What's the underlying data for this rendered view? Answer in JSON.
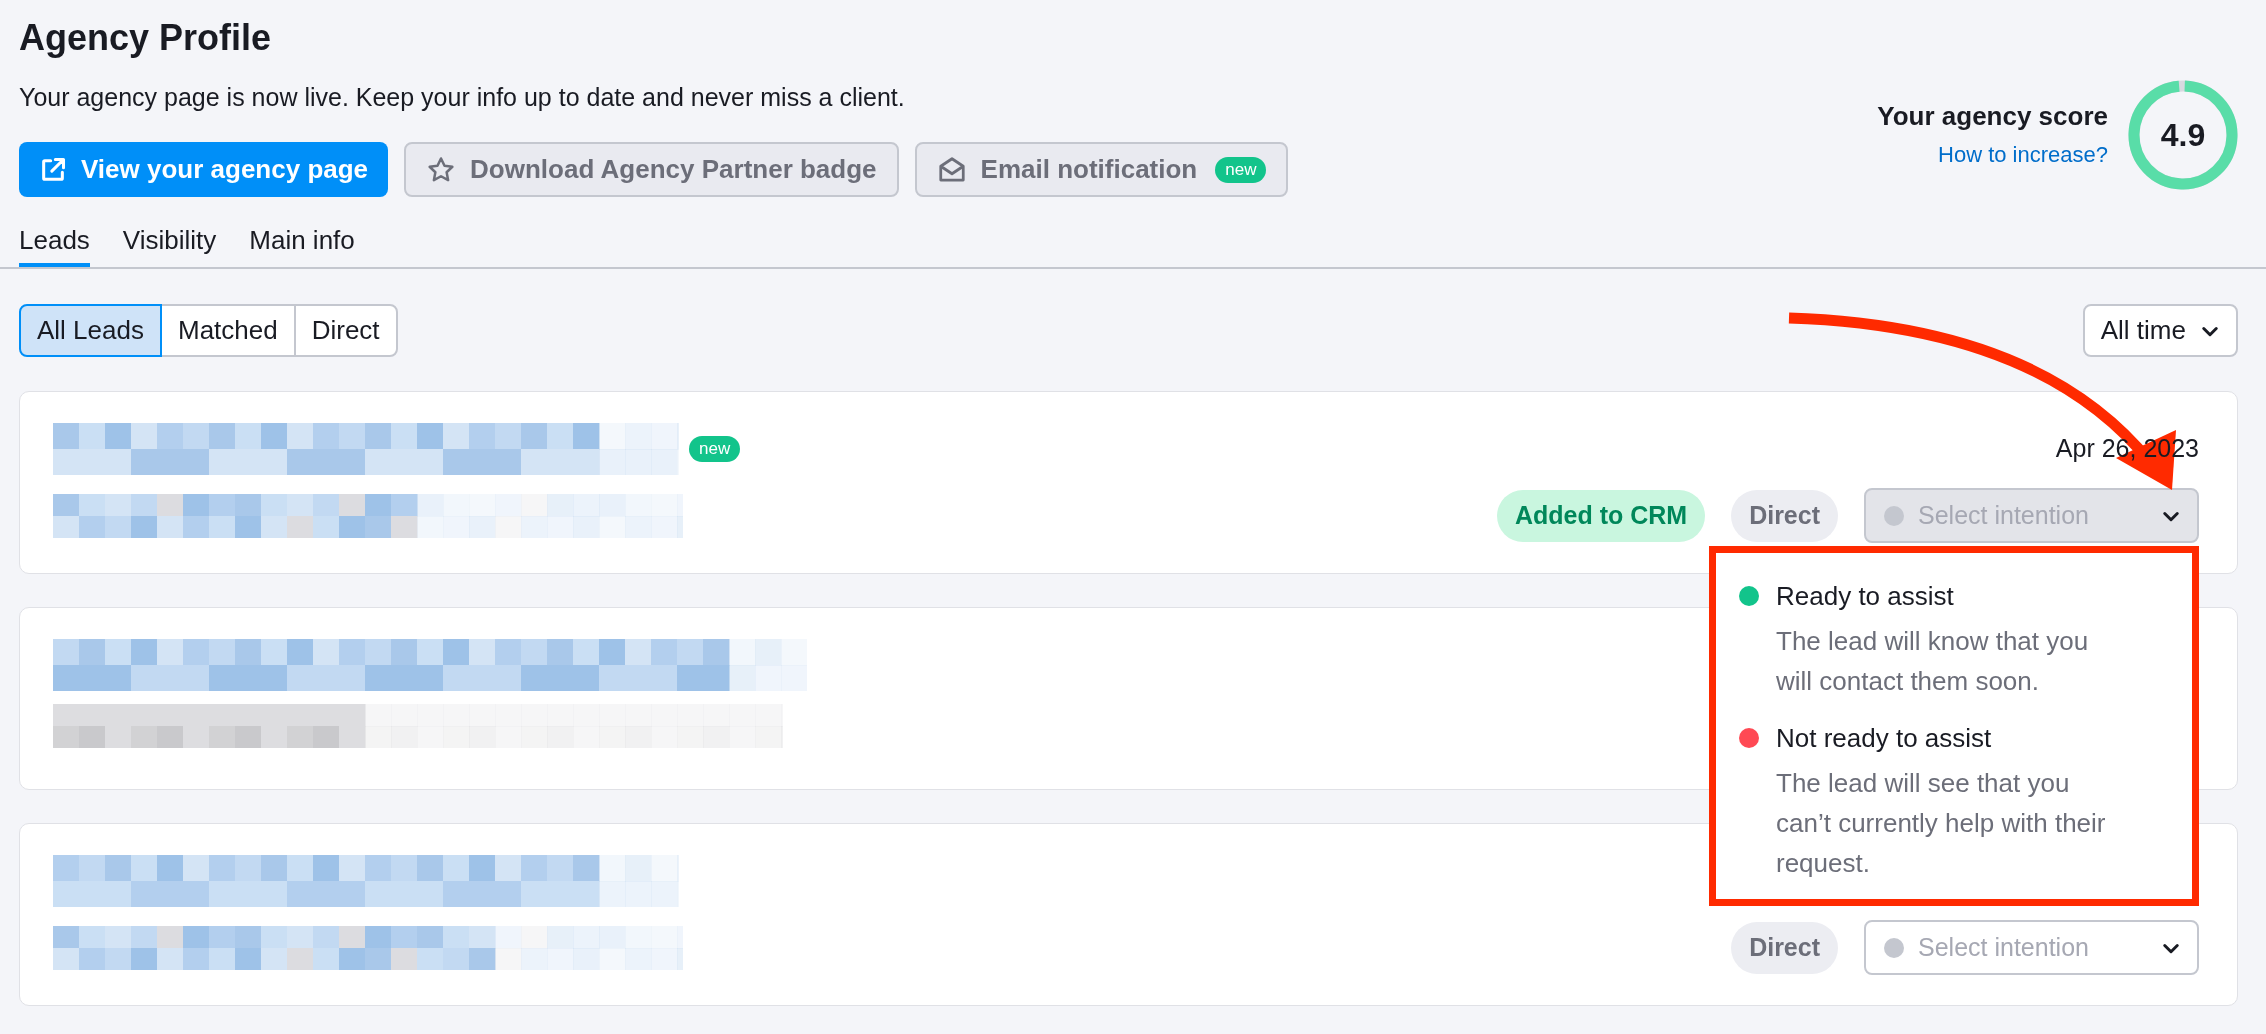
{
  "header": {
    "title": "Agency Profile",
    "subtitle": "Your agency page is now live. Keep your info up to date and never miss a client."
  },
  "actions": [
    {
      "label": "View your agency page",
      "kind": "primary"
    },
    {
      "label": "Download Agency Partner badge",
      "kind": "badge"
    },
    {
      "label": "Email notification",
      "kind": "email",
      "badge": "new"
    }
  ],
  "score": {
    "label": "Your agency score",
    "link": "How to increase?",
    "value": "4.9",
    "level": 0.98
  },
  "tabs": [
    {
      "label": "Leads",
      "selected": true
    },
    {
      "label": "Visibility",
      "selected": false
    },
    {
      "label": "Main info",
      "selected": false
    }
  ],
  "filters": [
    {
      "label": "All Leads",
      "selected": true
    },
    {
      "label": "Matched",
      "selected": false
    },
    {
      "label": "Direct",
      "selected": false
    }
  ],
  "period": {
    "value": "All time"
  },
  "leads": [
    {
      "is_new": true,
      "badge": "new",
      "date": "Apr 26, 2023",
      "tags": [
        {
          "label": "Added to CRM",
          "kind": "crm"
        },
        {
          "label": "Direct",
          "kind": "source"
        }
      ],
      "intention": {
        "placeholder": "Select intention",
        "open": true
      }
    },
    {
      "is_new": false
    },
    {
      "is_new": false,
      "tags": [
        {
          "label": "Direct",
          "kind": "source"
        }
      ],
      "intention": {
        "placeholder": "Select intention",
        "open": false
      }
    }
  ],
  "intention_menu": {
    "options": [
      {
        "label": "Ready to assist",
        "description": "The lead will know that you will contact them soon.",
        "color": "#12c48b"
      },
      {
        "label": "Not ready to assist",
        "description": "The lead will see that you can’t currently help with their request.",
        "color": "#ff4954"
      }
    ]
  }
}
